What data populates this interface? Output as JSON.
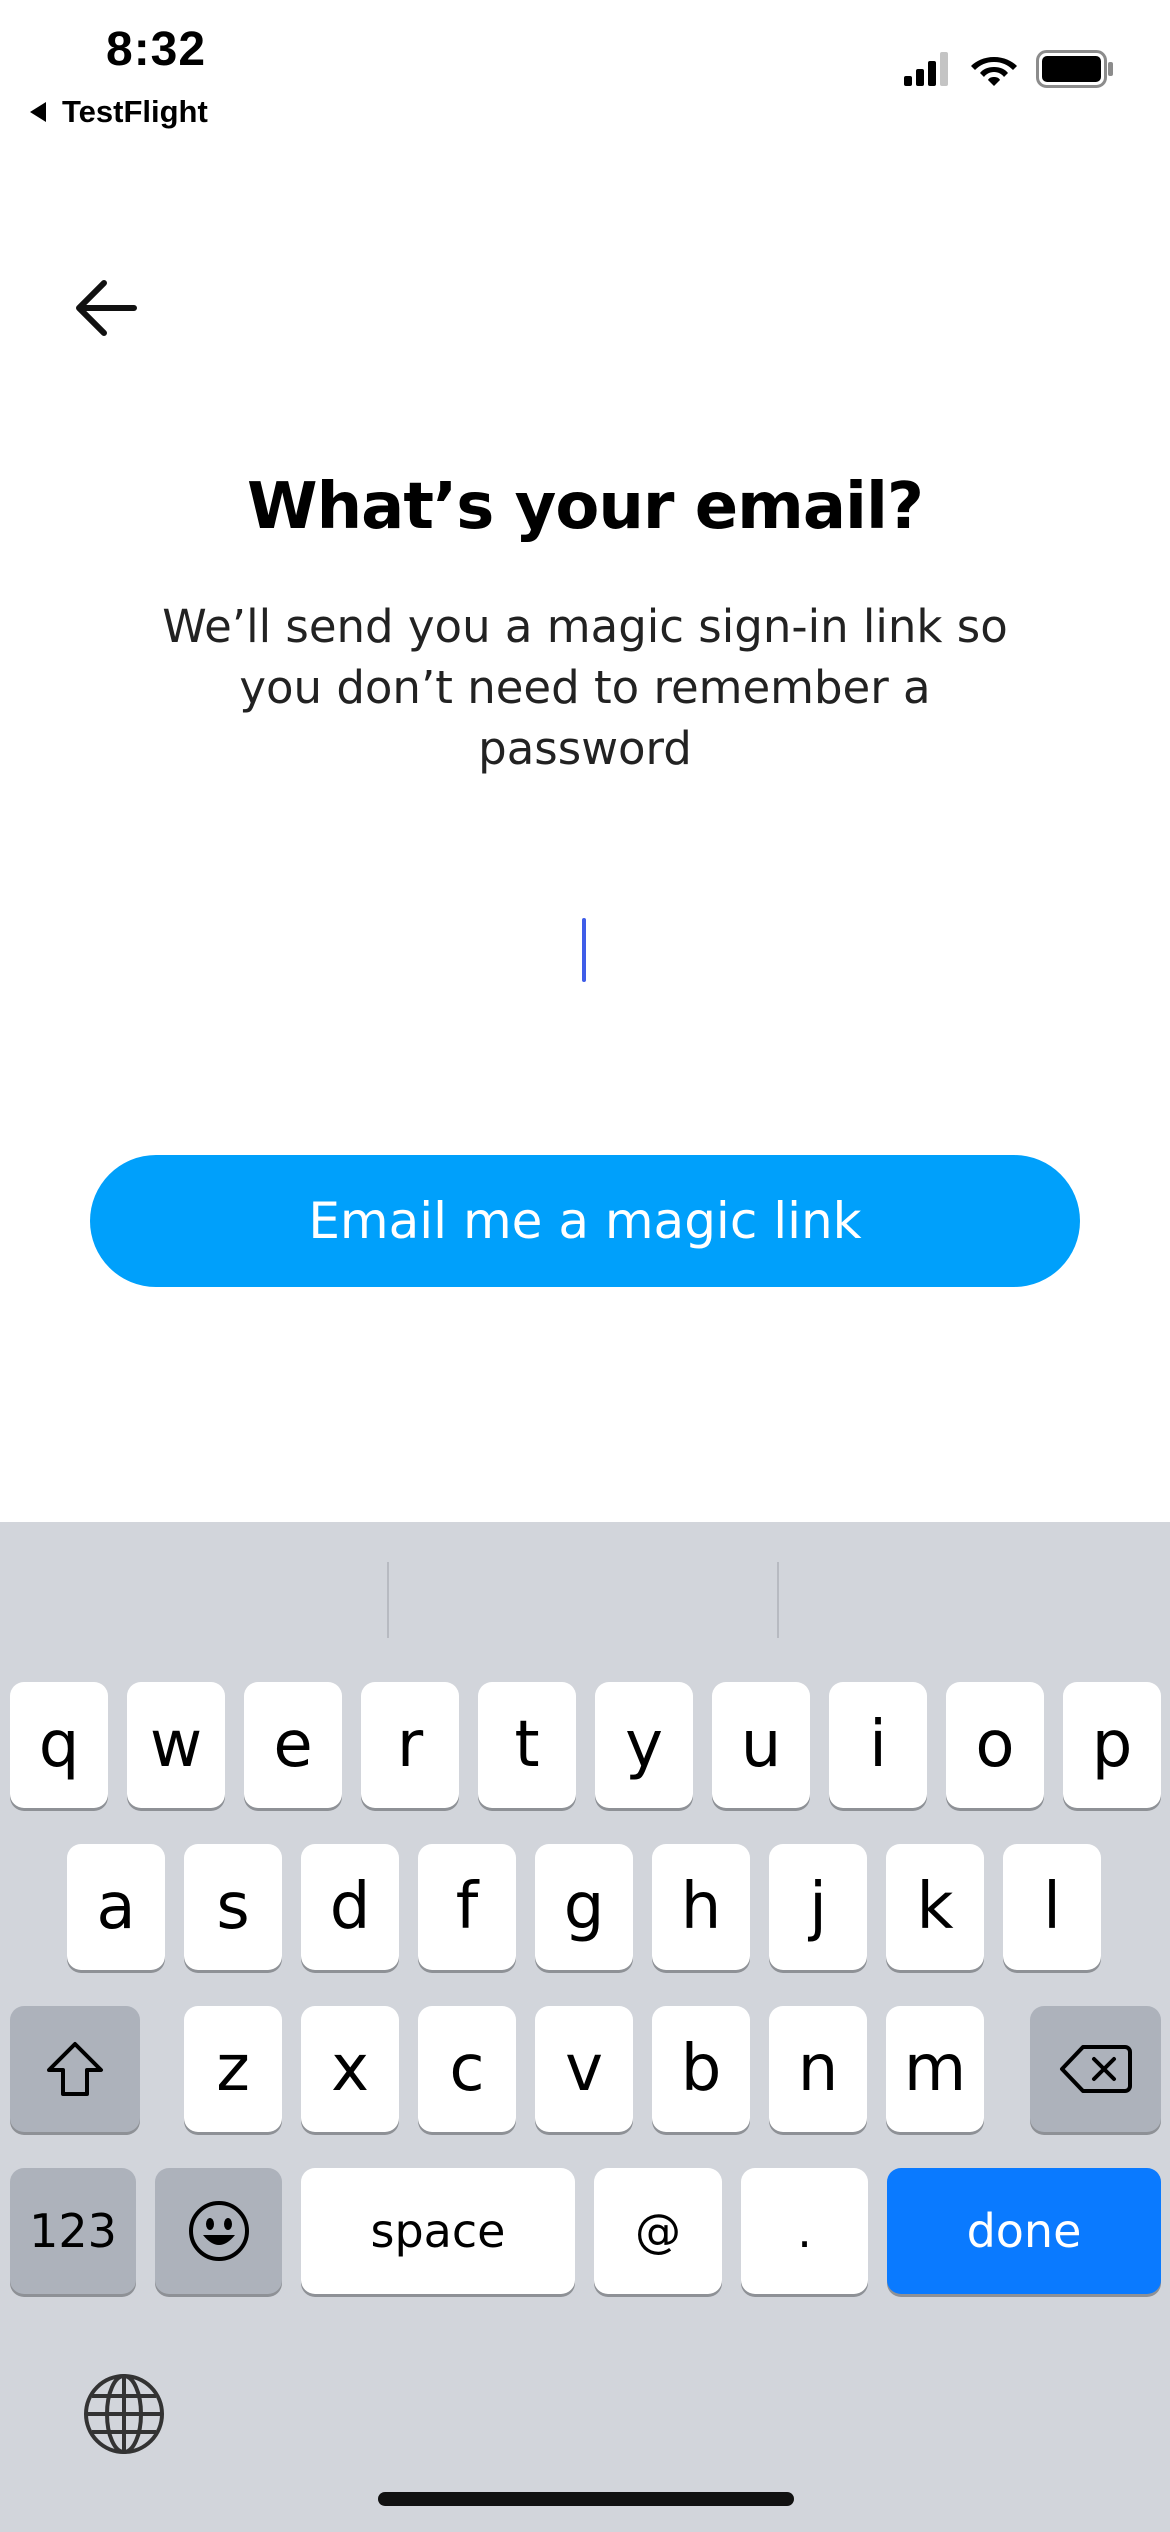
{
  "status_bar": {
    "time": "8:32",
    "back_app": "TestFlight",
    "icons": [
      "signal-icon",
      "wifi-icon",
      "battery-icon"
    ]
  },
  "header": {
    "back_icon": "arrow-left-icon"
  },
  "content": {
    "title": "What’s your email?",
    "subtitle": "We’ll send you a magic sign-in link so you don’t need to remember a password",
    "email_value": "",
    "email_placeholder": "",
    "button_label": "Email me a magic link"
  },
  "colors": {
    "primary_button": "#00a0fb",
    "caret": "#3f5de8",
    "done_key": "#0a7aff",
    "keyboard_bg": "#d2d5db"
  },
  "keyboard": {
    "row1": [
      "q",
      "w",
      "e",
      "r",
      "t",
      "y",
      "u",
      "i",
      "o",
      "p"
    ],
    "row2": [
      "a",
      "s",
      "d",
      "f",
      "g",
      "h",
      "j",
      "k",
      "l"
    ],
    "row3": [
      "z",
      "x",
      "c",
      "v",
      "b",
      "n",
      "m"
    ],
    "numbers_label": "123",
    "space_label": "space",
    "at_label": "@",
    "dot_label": ".",
    "done_label": "done",
    "shift_icon": "shift-icon",
    "delete_icon": "delete-icon",
    "emoji_icon": "emoji-icon",
    "globe_icon": "globe-icon"
  }
}
